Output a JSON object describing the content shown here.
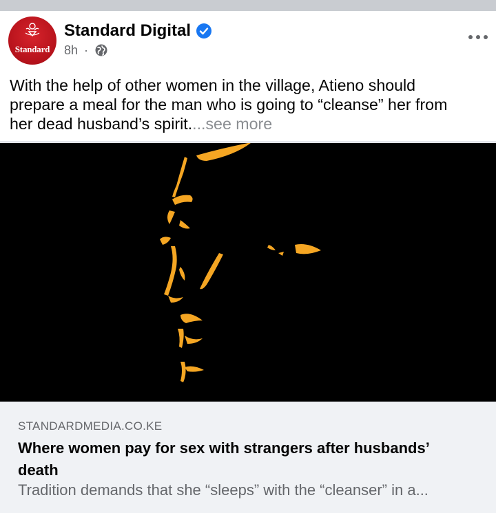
{
  "post": {
    "page_name": "Standard Digital",
    "avatar_text": "Standard",
    "timestamp": "8h",
    "separator": "·",
    "verified_icon": "verified-badge-icon",
    "audience_icon": "globe-icon",
    "more_icon": "more-options-icon",
    "text_lines": [
      "With the help of other women in the village, Atieno should",
      "prepare a meal for the man who is going to “cleanse” her from",
      "her dead husband’s spirit."
    ],
    "see_more": "...see more"
  },
  "link_preview": {
    "image_description": "silhouette-face-image",
    "domain": "STANDARDMEDIA.CO.KE",
    "title_lines": [
      "Where women pay for sex with strangers after husbands’",
      "death"
    ],
    "description": "Tradition demands that she “sleeps” with the “cleanser” in a..."
  },
  "colors": {
    "brand_red": "#c8161e",
    "verified_blue": "#1877f2",
    "secondary_text": "#65676b",
    "see_more_gray": "#8a8d91",
    "link_bg": "#f0f2f5",
    "silhouette_orange": "#f5a623"
  }
}
